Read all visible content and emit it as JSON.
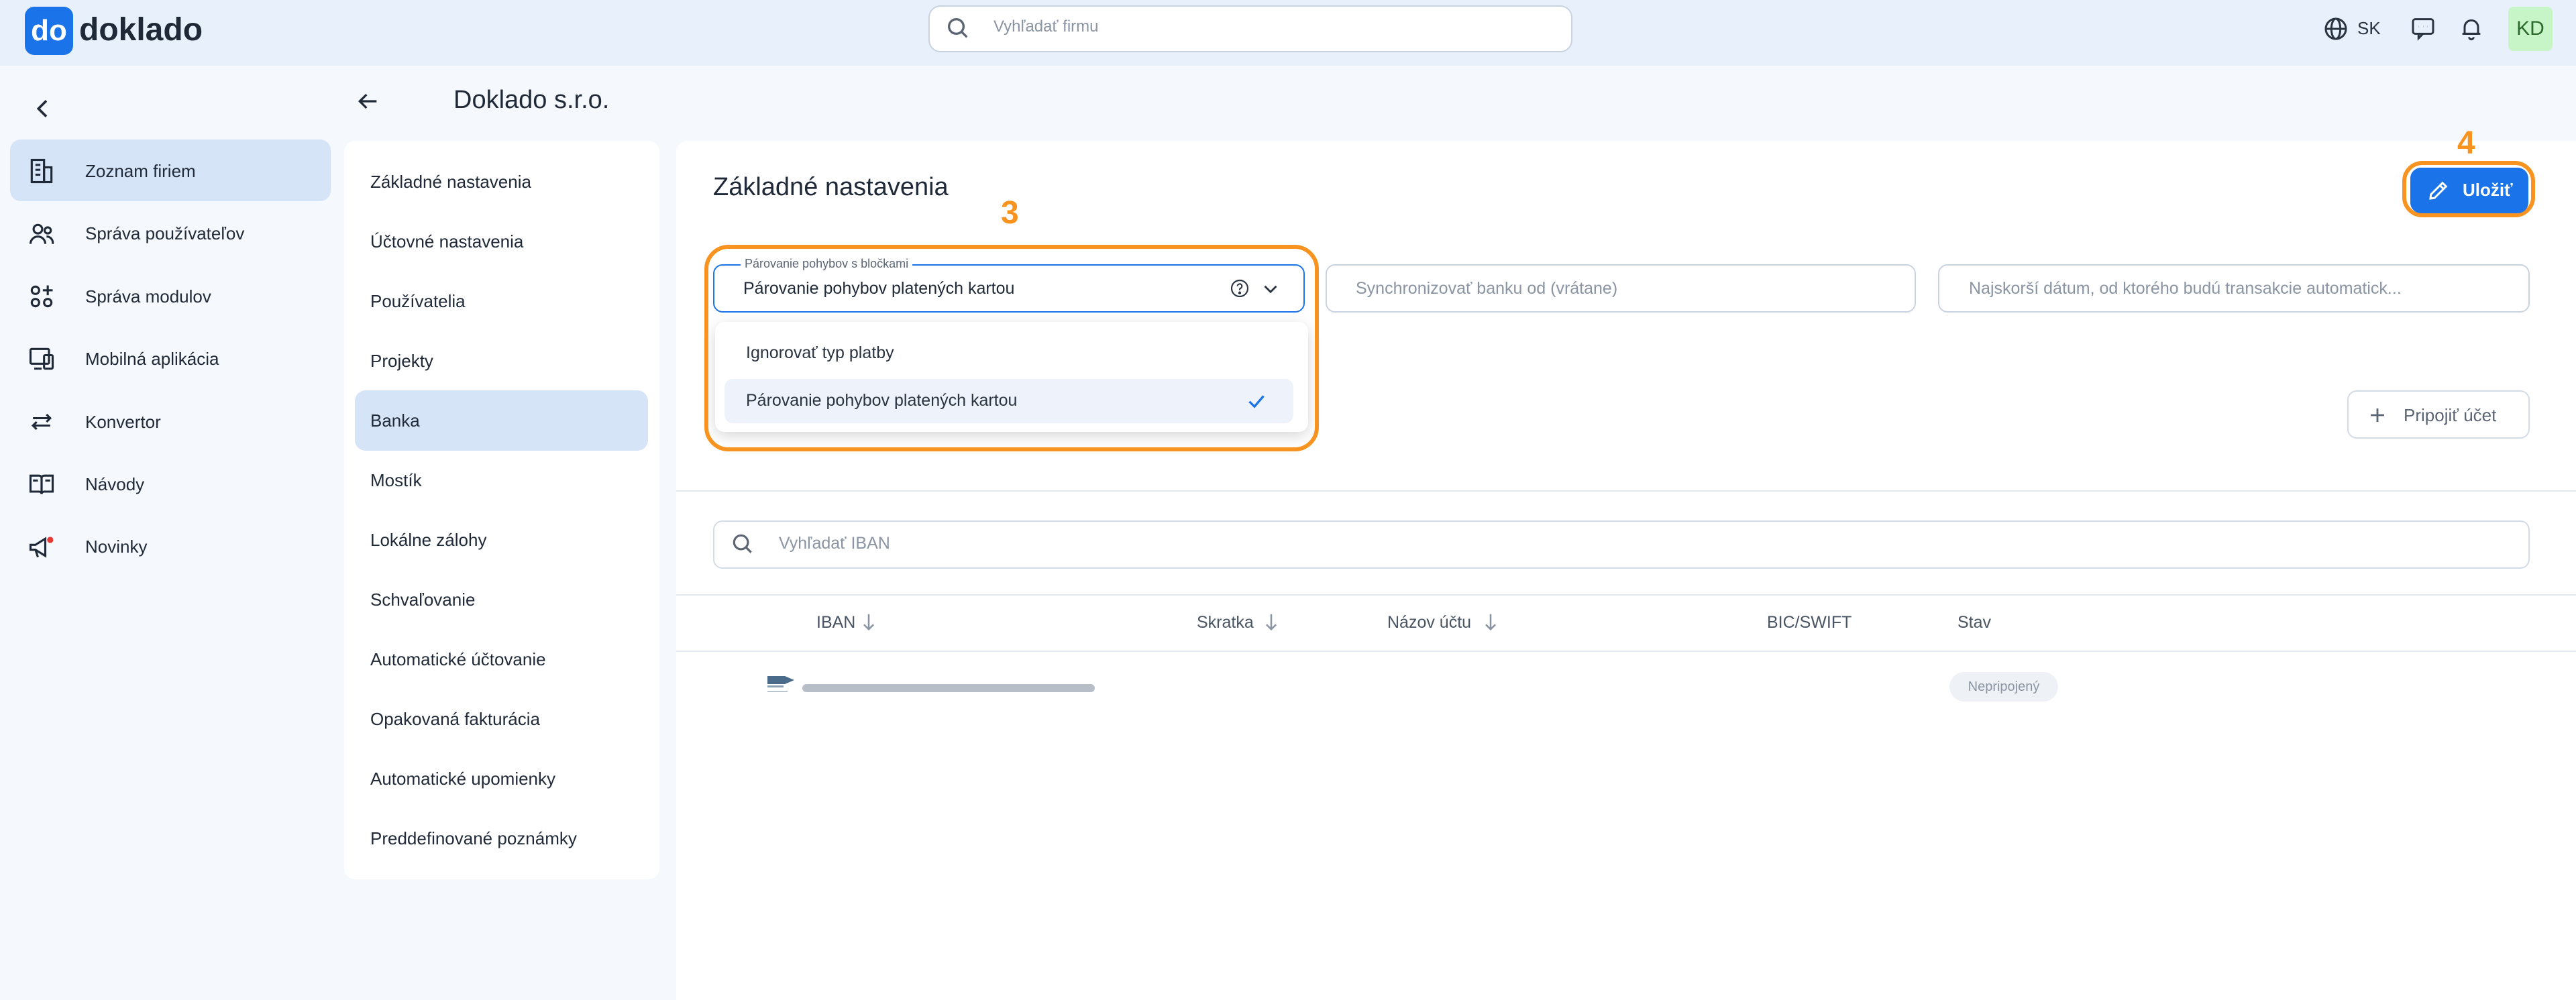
{
  "header": {
    "logo_mark": "do",
    "logo_text": "doklado",
    "search_placeholder": "Vyhľadať firmu",
    "language": "SK",
    "user_initials": "KD"
  },
  "sidebar": {
    "items": [
      {
        "label": "Zoznam firiem",
        "icon": "building-icon",
        "active": true
      },
      {
        "label": "Správa používateľov",
        "icon": "users-icon"
      },
      {
        "label": "Správa modulov",
        "icon": "modules-icon"
      },
      {
        "label": "Mobilná aplikácia",
        "icon": "mobile-app-icon"
      },
      {
        "label": "Konvertor",
        "icon": "convert-icon"
      },
      {
        "label": "Návody",
        "icon": "book-icon"
      },
      {
        "label": "Novinky",
        "icon": "megaphone-icon"
      }
    ]
  },
  "page": {
    "company_name": "Doklado s.r.o."
  },
  "settings_menu": {
    "items": [
      {
        "label": "Základné nastavenia"
      },
      {
        "label": "Účtovné nastavenia"
      },
      {
        "label": "Používatelia"
      },
      {
        "label": "Projekty"
      },
      {
        "label": "Banka",
        "active": true
      },
      {
        "label": "Mostík"
      },
      {
        "label": "Lokálne zálohy"
      },
      {
        "label": "Schvaľovanie"
      },
      {
        "label": "Automatické účtovanie"
      },
      {
        "label": "Opakovaná fakturácia"
      },
      {
        "label": "Automatické upomienky"
      },
      {
        "label": "Preddefinované poznámky"
      }
    ]
  },
  "main": {
    "section_title": "Základné nastavenia",
    "save_label": "Uložiť",
    "pairing_field": {
      "label": "Párovanie pohybov s bločkami",
      "value": "Párovanie pohybov platených kartou",
      "options": [
        {
          "label": "Ignorovať typ platby"
        },
        {
          "label": "Párovanie pohybov platených kartou",
          "selected": true
        }
      ]
    },
    "sync_placeholder": "Synchronizovať banku od (vrátane)",
    "earliest_date_placeholder": "Najskorší dátum, od ktorého budú transakcie automatick...",
    "connect_account_label": "Pripojiť účet",
    "iban_search_placeholder": "Vyhľadať IBAN",
    "table": {
      "columns": [
        "IBAN",
        "Skratka",
        "Názov účtu",
        "BIC/SWIFT",
        "Stav"
      ],
      "rows": [
        {
          "status": "Nepripojený"
        }
      ]
    }
  },
  "annotations": {
    "step_dropdown": "3",
    "step_save": "4",
    "highlight_color": "#f7931e"
  },
  "colors": {
    "accent": "#1a73e8",
    "active_bg": "#d6e4f8",
    "annotation": "#f7931e"
  }
}
